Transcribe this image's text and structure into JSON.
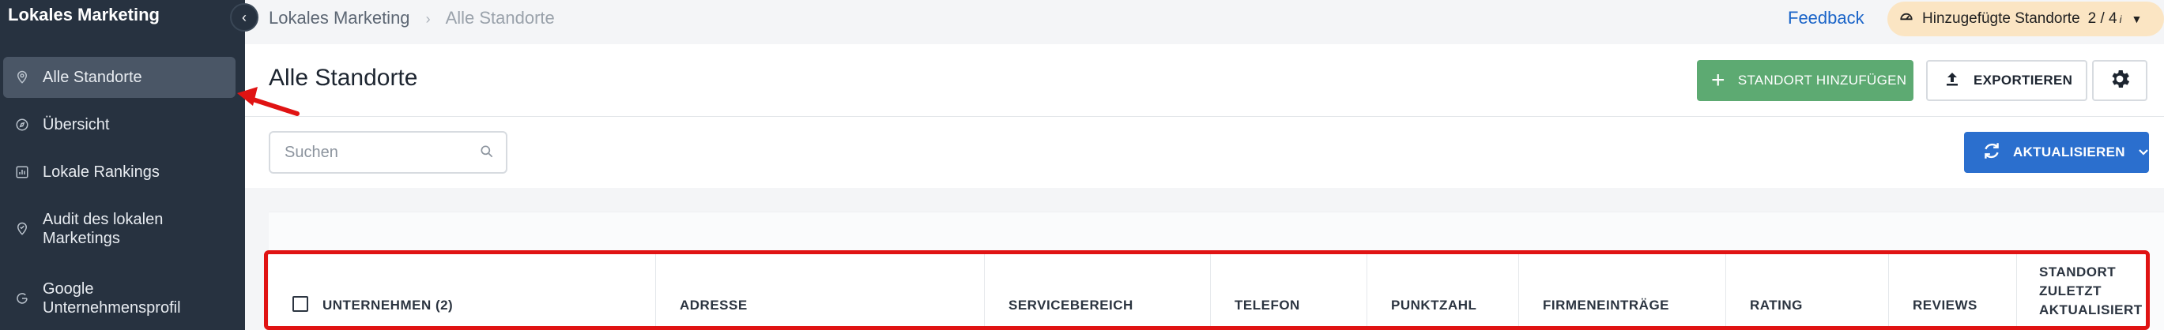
{
  "sidebar": {
    "title": "Lokales Marketing",
    "items": [
      {
        "label": "Alle Standorte",
        "icon": "map-pin-icon"
      },
      {
        "label": "Übersicht",
        "icon": "compass-icon"
      },
      {
        "label": "Lokale Rankings",
        "icon": "bar-chart-icon"
      },
      {
        "label": "Audit des lokalen Marketings",
        "icon": "shield-check-icon"
      },
      {
        "label": "Google Unternehmensprofil",
        "icon": "google-icon"
      }
    ]
  },
  "topbar": {
    "breadcrumb": [
      "Lokales Marketing",
      "Alle Standorte"
    ],
    "feedback": "Feedback",
    "added_locations": {
      "label": "Hinzugefügte Standorte",
      "count": "2 / 4",
      "info": "i"
    }
  },
  "header": {
    "title": "Alle Standorte",
    "add_button": "STANDORT HINZUFÜGEN",
    "export_button": "EXPORTIEREN"
  },
  "filters": {
    "search_placeholder": "Suchen",
    "refresh_button": "AKTUALISIEREN"
  },
  "table": {
    "columns": [
      "UNTERNEHMEN (2)",
      "ADRESSE",
      "SERVICEBEREICH",
      "TELEFON",
      "PUNKTZAHL",
      "FIRMENEINTRÄGE",
      "RATING",
      "REVIEWS",
      "STANDORT ZULETZT AKTUALISIERT"
    ]
  },
  "colors": {
    "sidebar_bg": "#273240",
    "add_button": "#5daa72",
    "refresh_button": "#2b6fce",
    "highlight": "#e01313",
    "added_badge": "#fbe5c3"
  }
}
